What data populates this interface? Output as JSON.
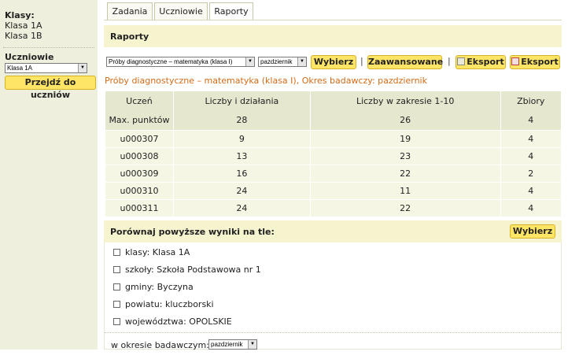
{
  "sidebar": {
    "classes_label": "Klasy:",
    "classes": [
      "Klasa 1A",
      "Klasa 1B"
    ],
    "students_label": "Uczniowie",
    "class_select_value": "Klasa 1A",
    "go_button": "Przejdź do uczniów"
  },
  "tabs": [
    {
      "label": "Zadania"
    },
    {
      "label": "Uczniowie"
    },
    {
      "label": "Raporty"
    }
  ],
  "header": {
    "title": "Raporty"
  },
  "toolbar": {
    "test_select_value": "Próby diagnostyczne – matematyka (klasa I)",
    "period_select_value": "pazdziernik",
    "choose_button": "Wybierz",
    "advanced_button": "Zaawansowane",
    "separator": "|",
    "export_xls": "Eksport",
    "export_pdf": "Eksport"
  },
  "report_title": "Próby diagnostyczne – matematyka (klasa I), Okres badawczy: pazdziernik",
  "table": {
    "columns": [
      "Uczeń",
      "Liczby i działania",
      "Liczby w zakresie 1-10",
      "Zbiory"
    ],
    "max_row": [
      "Max. punktów",
      "28",
      "26",
      "4"
    ],
    "rows": [
      [
        "u000307",
        "9",
        "19",
        "4"
      ],
      [
        "u000308",
        "13",
        "23",
        "4"
      ],
      [
        "u000309",
        "16",
        "22",
        "2"
      ],
      [
        "u000310",
        "24",
        "11",
        "4"
      ],
      [
        "u000311",
        "24",
        "22",
        "4"
      ]
    ]
  },
  "compare": {
    "title": "Porównaj powyższe wyniki na tle:",
    "choose_button": "Wybierz",
    "options": [
      {
        "label": "klasy: Klasa 1A",
        "checked": false
      },
      {
        "label": "szkoły: Szkoła Podstawowa nr 1",
        "checked": false
      },
      {
        "label": "gminy: Byczyna",
        "checked": false
      },
      {
        "label": "powiatu: kluczborski",
        "checked": false
      },
      {
        "label": "województwa: OPOLSKIE",
        "checked": false
      }
    ],
    "period_label": "w okresie badawczym:",
    "period_select_value": "pazdziernik"
  },
  "icons": {
    "dropdown": "chevron-down-icon",
    "export_xls": "spreadsheet-icon",
    "export_pdf": "pdf-icon",
    "checkbox": "checkbox-icon"
  },
  "colors": {
    "sidebar_bg": "#eeefdc",
    "header_bg": "#f6f4cf",
    "button_bg": "#ffe566",
    "title_orange": "#d36b17",
    "table_head_bg": "#e6e7cf",
    "table_row_bg": "#f5f6e4"
  }
}
